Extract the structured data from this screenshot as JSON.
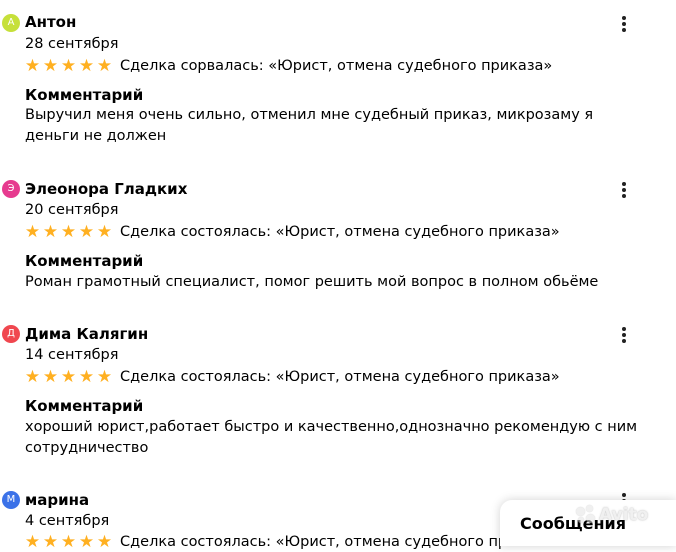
{
  "reviews": [
    {
      "avatar_letter": "А",
      "avatar_color": "#c6e03a",
      "name": "Антон",
      "date": "28 сентября",
      "rating": 5,
      "deal": "Сделка сорвалась: «Юрист, отмена судебного приказа»",
      "comment_label": "Комментарий",
      "comment": "Выручил меня очень сильно, отменил мне судебный приказ, микрозаму я деньги не должен"
    },
    {
      "avatar_letter": "Э",
      "avatar_color": "#e63b8f",
      "name": "Элеонора Гладких",
      "date": "20 сентября",
      "rating": 5,
      "deal": "Сделка состоялась: «Юрист, отмена судебного приказа»",
      "comment_label": "Комментарий",
      "comment": "Роман грамотный специалист, помог решить мой вопрос в полном обьёме"
    },
    {
      "avatar_letter": "Д",
      "avatar_color": "#f0474f",
      "name": "Дима Калягин",
      "date": "14 сентября",
      "rating": 5,
      "deal": "Сделка состоялась: «Юрист, отмена судебного приказа»",
      "comment_label": "Комментарий",
      "comment": "хороший юрист,работает быстро и качественно,однозначно рекомендую с ним сотрудничество"
    },
    {
      "avatar_letter": "М",
      "avatar_color": "#3b72e8",
      "name": "марина",
      "date": "4 сентября",
      "rating": 5,
      "deal": "Сделка состоялась: «Юрист, отмена судебного приказа»",
      "comment_label": "",
      "comment": ""
    }
  ],
  "star_color": "#ffb021",
  "messages_button": {
    "label": "Сообщения"
  },
  "watermark": {
    "text": "Avito"
  }
}
